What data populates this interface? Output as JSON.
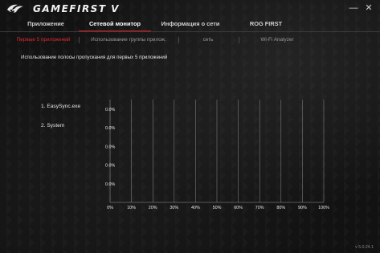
{
  "window": {
    "title": "GAMEFIRST V"
  },
  "controls": {
    "minimize": "—",
    "close": "✕"
  },
  "tabs": [
    {
      "label": "Приложение"
    },
    {
      "label": "Сетевой монитор"
    },
    {
      "label": "Информация о сети"
    },
    {
      "label": "ROG FIRST"
    }
  ],
  "subtabs": [
    {
      "label": "Первые 5 приложений"
    },
    {
      "label": "Использование группы прилож."
    },
    {
      "label": "сеть"
    },
    {
      "label": "Wi-Fi Analyzer"
    }
  ],
  "section": {
    "title": "Использование полосы пропускания для первых 5 приложений"
  },
  "apps": [
    {
      "label": "1. EasySync.exe"
    },
    {
      "label": "2. System"
    }
  ],
  "chart_data": {
    "type": "bar",
    "orientation": "horizontal",
    "title": "",
    "categories": [
      "",
      "",
      "",
      "",
      ""
    ],
    "values": [
      0,
      0,
      0,
      0,
      0
    ],
    "value_labels": [
      "0.0%",
      "0.0%",
      "0.0%",
      "0.0%",
      "0.0%"
    ],
    "x_ticks": [
      "0%",
      "10%",
      "20%",
      "30%",
      "40%",
      "50%",
      "60%",
      "70%",
      "80%",
      "90%",
      "100%"
    ],
    "xlim": [
      0,
      100
    ],
    "grid": true,
    "colors": {
      "grid": "#8c8c8c",
      "axis": "#9c9c9c",
      "text": "#e6e6e6"
    }
  },
  "footer": {
    "version": "v 5.0.24.1"
  },
  "colors": {
    "accent": "#e0181b",
    "background": "#121212"
  }
}
